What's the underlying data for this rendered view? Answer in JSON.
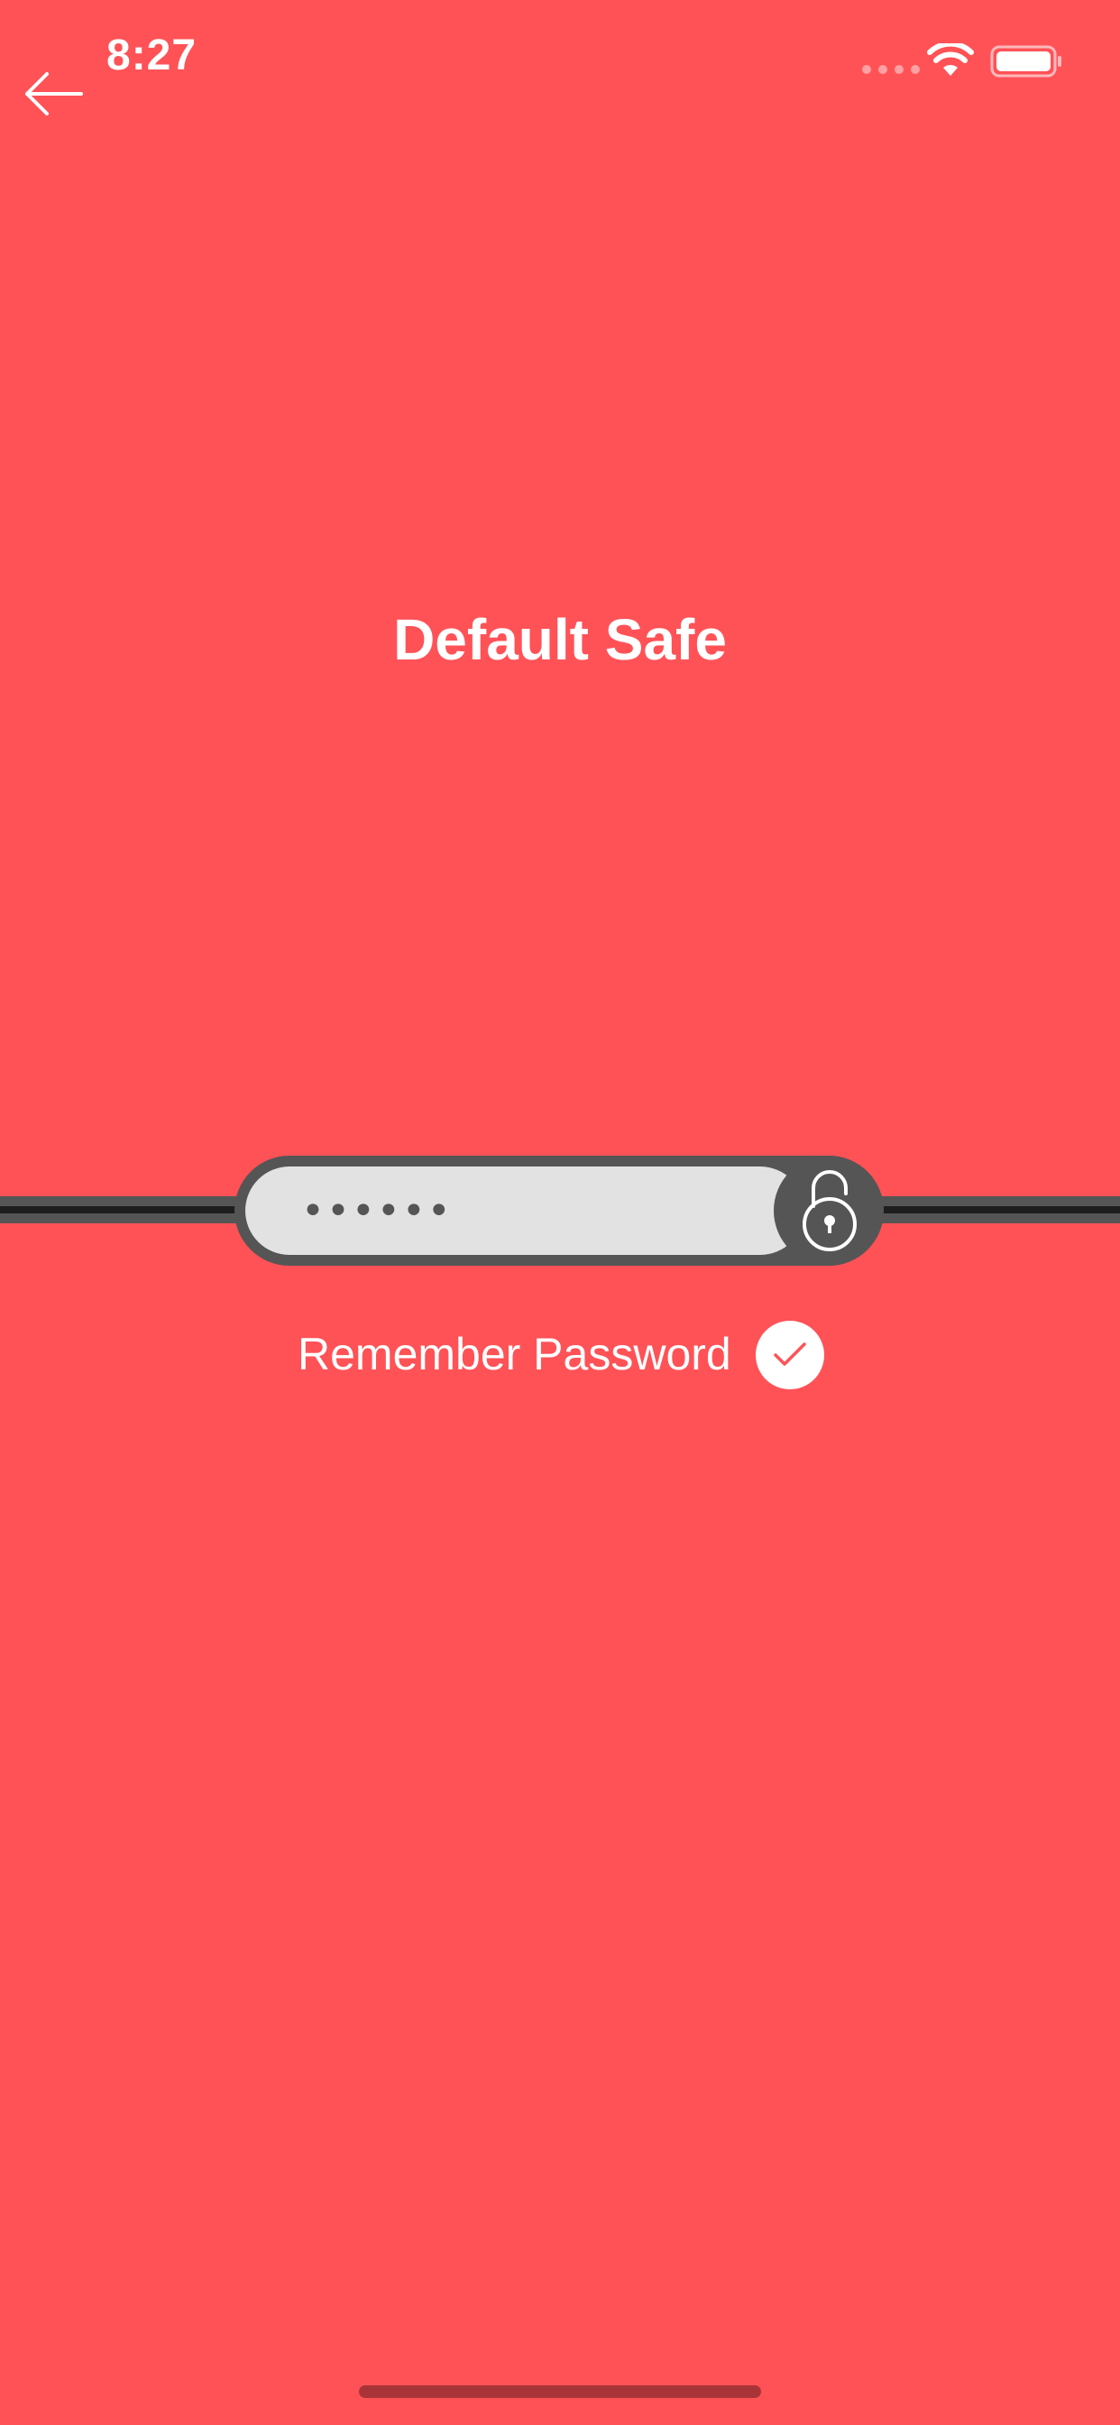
{
  "status_bar": {
    "time": "8:27"
  },
  "navigation": {
    "back_icon": "arrow-left-icon"
  },
  "page": {
    "title": "Default Safe"
  },
  "password": {
    "masked_value": "••••••",
    "lock_icon": "unlocked-padlock-icon"
  },
  "remember": {
    "label": "Remember Password",
    "checked": true,
    "check_icon": "checkmark-icon"
  },
  "colors": {
    "background": "#ff5257",
    "field": "#e2e2e2",
    "pill": "#555555",
    "text": "#ffffff"
  }
}
